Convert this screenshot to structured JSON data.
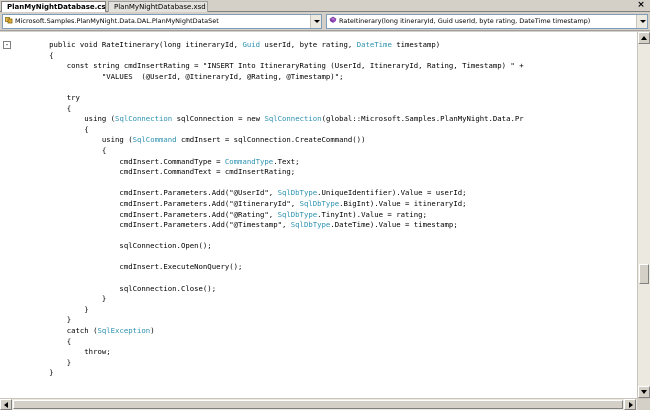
{
  "tabs": [
    {
      "label": "PlanMyNightDatabase.cs",
      "active": true
    },
    {
      "label": "PlanMyNightDatabase.xsd",
      "active": false
    }
  ],
  "close_icon": "close-icon",
  "navbar": {
    "type_combo": {
      "value": "Microsoft.Samples.PlanMyNight.Data.DAL.PlanMyNightDataSet",
      "icon": "class-icon"
    },
    "member_combo": {
      "value": "RateItinerary(long itineraryId, Guid userId, byte rating, DateTime timestamp)",
      "icon": "method-icon"
    }
  },
  "colors": {
    "type_name": "#2b91af",
    "code_text": "#000000",
    "editor_bg": "#ffffff"
  },
  "code_lines": [
    [
      {
        "t": "        public void RateItinerary(long itineraryId, "
      },
      {
        "t": "Guid",
        "c": "type"
      },
      {
        "t": " userId, byte rating, "
      },
      {
        "t": "DateTime",
        "c": "type"
      },
      {
        "t": " timestamp)"
      }
    ],
    [
      {
        "t": "        {"
      }
    ],
    [
      {
        "t": "            const string cmdInsertRating = \"INSERT Into ItineraryRating (UserId, ItineraryId, Rating, Timestamp) \" +"
      }
    ],
    [
      {
        "t": "                    \"VALUES  (@UserId, @ItineraryId, @Rating, @Timestamp)\";"
      }
    ],
    [
      {
        "t": ""
      }
    ],
    [
      {
        "t": "            try"
      }
    ],
    [
      {
        "t": "            {"
      }
    ],
    [
      {
        "t": "                using ("
      },
      {
        "t": "SqlConnection",
        "c": "type"
      },
      {
        "t": " sqlConnection = new "
      },
      {
        "t": "SqlConnection",
        "c": "type"
      },
      {
        "t": "(global::Microsoft.Samples.PlanMyNight.Data.Pr"
      }
    ],
    [
      {
        "t": "                {"
      }
    ],
    [
      {
        "t": "                    using ("
      },
      {
        "t": "SqlCommand",
        "c": "type"
      },
      {
        "t": " cmdInsert = sqlConnection.CreateCommand())"
      }
    ],
    [
      {
        "t": "                    {"
      }
    ],
    [
      {
        "t": "                        cmdInsert.CommandType = "
      },
      {
        "t": "CommandType",
        "c": "type"
      },
      {
        "t": ".Text;"
      }
    ],
    [
      {
        "t": "                        cmdInsert.CommandText = cmdInsertRating;"
      }
    ],
    [
      {
        "t": ""
      }
    ],
    [
      {
        "t": "                        cmdInsert.Parameters.Add(\"@UserId\", "
      },
      {
        "t": "SqlDbType",
        "c": "type"
      },
      {
        "t": ".UniqueIdentifier).Value = userId;"
      }
    ],
    [
      {
        "t": "                        cmdInsert.Parameters.Add(\"@ItineraryId\", "
      },
      {
        "t": "SqlDbType",
        "c": "type"
      },
      {
        "t": ".BigInt).Value = itineraryId;"
      }
    ],
    [
      {
        "t": "                        cmdInsert.Parameters.Add(\"@Rating\", "
      },
      {
        "t": "SqlDbType",
        "c": "type"
      },
      {
        "t": ".TinyInt).Value = rating;"
      }
    ],
    [
      {
        "t": "                        cmdInsert.Parameters.Add(\"@Timestamp\", "
      },
      {
        "t": "SqlDbType",
        "c": "type"
      },
      {
        "t": ".DateTime).Value = timestamp;"
      }
    ],
    [
      {
        "t": ""
      }
    ],
    [
      {
        "t": "                        sqlConnection.Open();"
      }
    ],
    [
      {
        "t": ""
      }
    ],
    [
      {
        "t": "                        cmdInsert.ExecuteNonQuery();"
      }
    ],
    [
      {
        "t": ""
      }
    ],
    [
      {
        "t": "                        sqlConnection.Close();"
      }
    ],
    [
      {
        "t": "                    }"
      }
    ],
    [
      {
        "t": "                }"
      }
    ],
    [
      {
        "t": "            }"
      }
    ],
    [
      {
        "t": "            catch ("
      },
      {
        "t": "SqlException",
        "c": "type"
      },
      {
        "t": ")"
      }
    ],
    [
      {
        "t": "            {"
      }
    ],
    [
      {
        "t": "                throw;"
      }
    ],
    [
      {
        "t": "            }"
      }
    ],
    [
      {
        "t": "        }"
      }
    ]
  ],
  "collapse_markers": [
    "-"
  ]
}
